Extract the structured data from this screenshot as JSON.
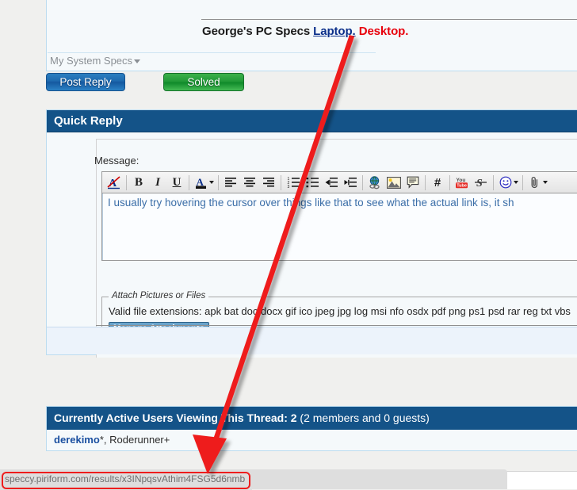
{
  "post": {
    "signature_prefix": "George's PC Specs ",
    "signature_link": "Laptop.",
    "signature_red": " Desktop.",
    "system_specs_label": "My System Specs"
  },
  "actions": {
    "post_reply_label": "Post Reply",
    "solved_label": "Solved"
  },
  "quick_reply": {
    "title": "Quick Reply",
    "message_label": "Message:",
    "message_text": "I usually try hovering the cursor over things like that to see what the actual link is, it sh",
    "toolbar": [
      {
        "name": "remove-formatting-icon",
        "glyph": "A",
        "title": "Remove Text Formatting"
      },
      {
        "name": "bold-icon",
        "glyph": "B",
        "title": "Bold"
      },
      {
        "name": "italic-icon",
        "glyph": "I",
        "title": "Italic"
      },
      {
        "name": "underline-icon",
        "glyph": "U",
        "title": "Underline"
      },
      {
        "name": "font-color-icon",
        "glyph": "A",
        "title": "Font Color"
      },
      {
        "name": "align-left-icon",
        "glyph": "",
        "title": "Align Left"
      },
      {
        "name": "align-center-icon",
        "glyph": "",
        "title": "Align Center"
      },
      {
        "name": "align-right-icon",
        "glyph": "",
        "title": "Align Right"
      },
      {
        "name": "ordered-list-icon",
        "glyph": "",
        "title": "Numbered List"
      },
      {
        "name": "unordered-list-icon",
        "glyph": "",
        "title": "Bulleted List"
      },
      {
        "name": "outdent-icon",
        "glyph": "",
        "title": "Decrease Indent"
      },
      {
        "name": "indent-icon",
        "glyph": "",
        "title": "Increase Indent"
      },
      {
        "name": "insert-link-icon",
        "glyph": "",
        "title": "Insert Link"
      },
      {
        "name": "insert-image-icon",
        "glyph": "",
        "title": "Insert Image"
      },
      {
        "name": "insert-quote-icon",
        "glyph": "",
        "title": "Wrap in Quote Tags"
      },
      {
        "name": "insert-code-icon",
        "glyph": "#",
        "title": "Insert Code"
      },
      {
        "name": "youtube-icon",
        "glyph": "You",
        "title": "Insert Video"
      },
      {
        "name": "strikethrough-icon",
        "glyph": "S",
        "title": "Strikethrough"
      },
      {
        "name": "smilie-icon",
        "glyph": "",
        "title": "Smilies"
      },
      {
        "name": "attachment-icon",
        "glyph": "",
        "title": "Attachments"
      }
    ],
    "attachments": {
      "legend": "Attach Pictures or Files",
      "extensions_text": "Valid file extensions: apk bat doc docx gif ico jpeg jpg log msi nfo osdx pdf png ps1 psd rar reg txt vbs",
      "manage_button": "Manage Attachments"
    }
  },
  "active_users": {
    "title_bold": "Currently Active Users Viewing This Thread: 2",
    "title_normal": " (2 members and 0 guests)",
    "user_1": "derekimo",
    "user_1_suffix": "*,",
    "user_2": "Roderunner+"
  },
  "statusbar": {
    "url": "speccy.piriform.com/results/x3INpqsvAthim4FSG5d6nmb"
  },
  "colors": {
    "panel_header_blue": "#145388",
    "accent_red": "#ee1d1d",
    "link_blue": "#1a4fa0",
    "button_blue": "#1f6bb0",
    "button_green": "#229a38"
  }
}
